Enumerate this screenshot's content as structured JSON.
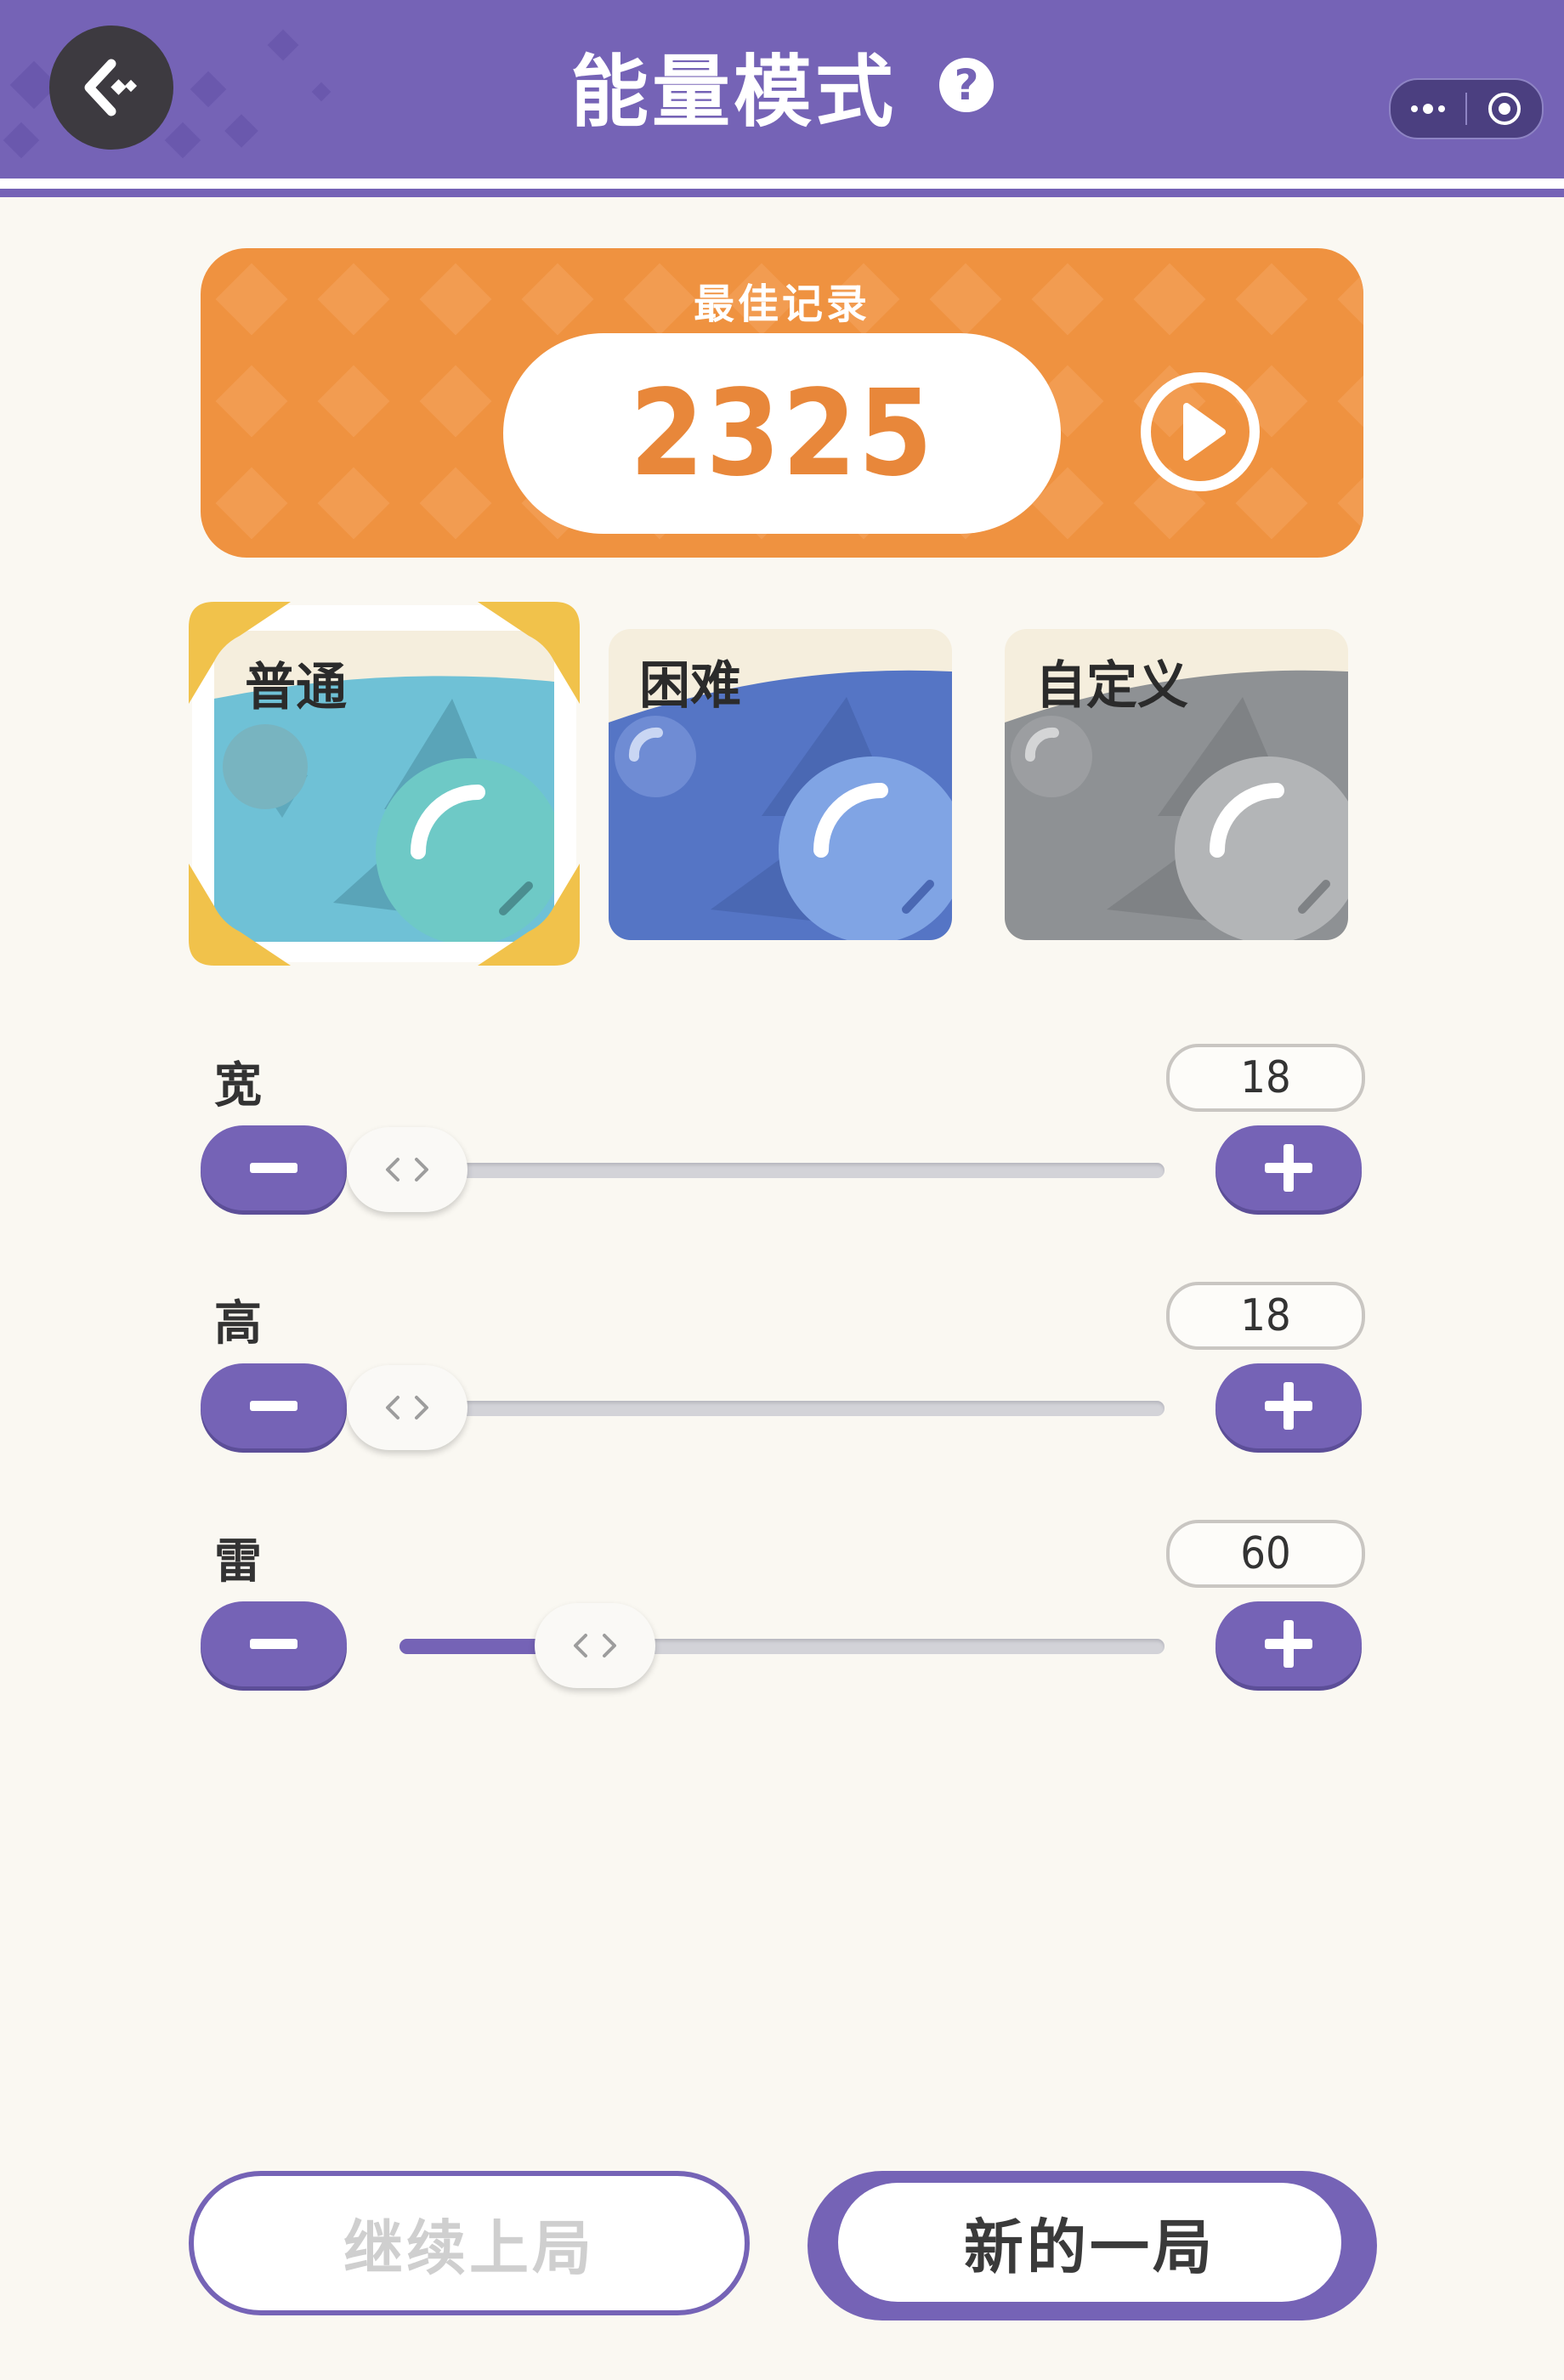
{
  "header": {
    "title": "能量模式",
    "help_symbol": "?",
    "background_color": "#7563b6"
  },
  "record": {
    "label": "最佳记录",
    "score": "2325",
    "accent_color": "#ef9240"
  },
  "modes": [
    {
      "label": "普通",
      "selected": true,
      "color": "#6fc1d6"
    },
    {
      "label": "困难",
      "selected": false,
      "color": "#5575c5"
    },
    {
      "label": "自定义",
      "selected": false,
      "color": "#8e9194"
    }
  ],
  "sliders": [
    {
      "label": "宽",
      "value": "18",
      "fraction": 0.0
    },
    {
      "label": "高",
      "value": "18",
      "fraction": 0.0
    },
    {
      "label": "雷",
      "value": "60",
      "fraction": 0.27
    }
  ],
  "buttons": {
    "continue_label": "继续上局",
    "new_label": "新的一局"
  },
  "icons": {
    "back": "back-diamond-icon",
    "more": "more-dots-icon",
    "close": "target-circle-icon",
    "play": "play-icon",
    "minus": "minus-icon",
    "plus": "plus-icon"
  }
}
